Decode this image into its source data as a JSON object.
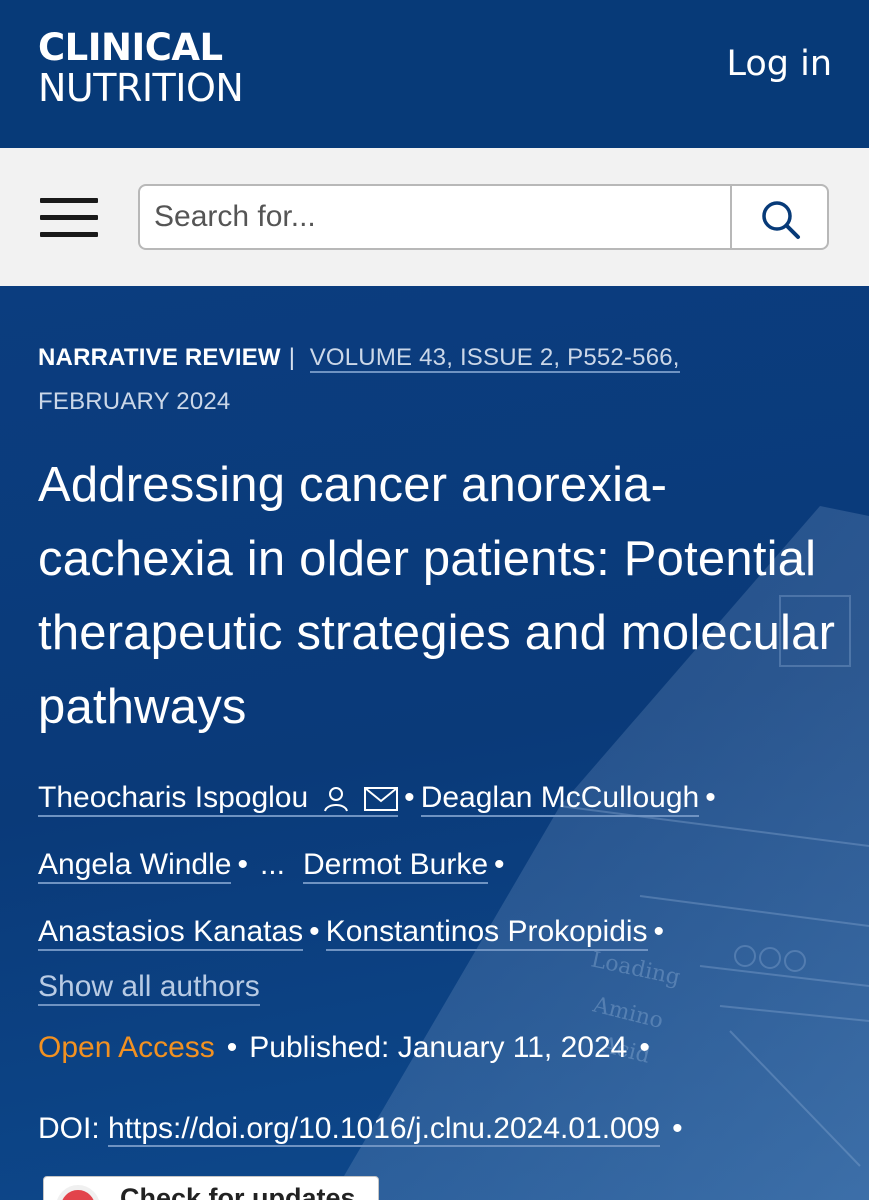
{
  "header": {
    "logo_line1": "CLINICAL",
    "logo_line2": "NUTRITION",
    "login_label": "Log in",
    "background_color": "#073a78"
  },
  "search": {
    "placeholder": "Search for...",
    "menu_icon": "hamburger-menu-icon",
    "search_icon": "magnifier-icon"
  },
  "article": {
    "type": "NARRATIVE REVIEW",
    "separator": "|",
    "volume_issue_pages": "VOLUME 43, ISSUE 2, P552-566,",
    "date": "FEBRUARY 2024",
    "title": "Addressing cancer anorexia-cachexia in older patients: Potential therapeutic strategies and molecular pathways",
    "authors": [
      "Theocharis Ispoglou",
      "Deaglan McCullough",
      "Angela Windle",
      "Dermot Burke",
      "Anastasios Kanatas",
      "Konstantinos Prokopidis"
    ],
    "authors_ellipsis": "...",
    "show_all_authors": "Show all authors",
    "access": "Open Access",
    "published": "Published: January 11, 2024",
    "doi_label": "DOI:",
    "doi_url": "https://doi.org/10.1016/j.clnu.2024.01.009",
    "check_updates": "Check for updates",
    "bullet": "•"
  },
  "colors": {
    "hero_bg": "#0b3a78",
    "open_access": "#f29121",
    "link_underline": "#6f93c2"
  },
  "background_figure_text": [
    "Loading",
    "Amino",
    "Acid"
  ]
}
